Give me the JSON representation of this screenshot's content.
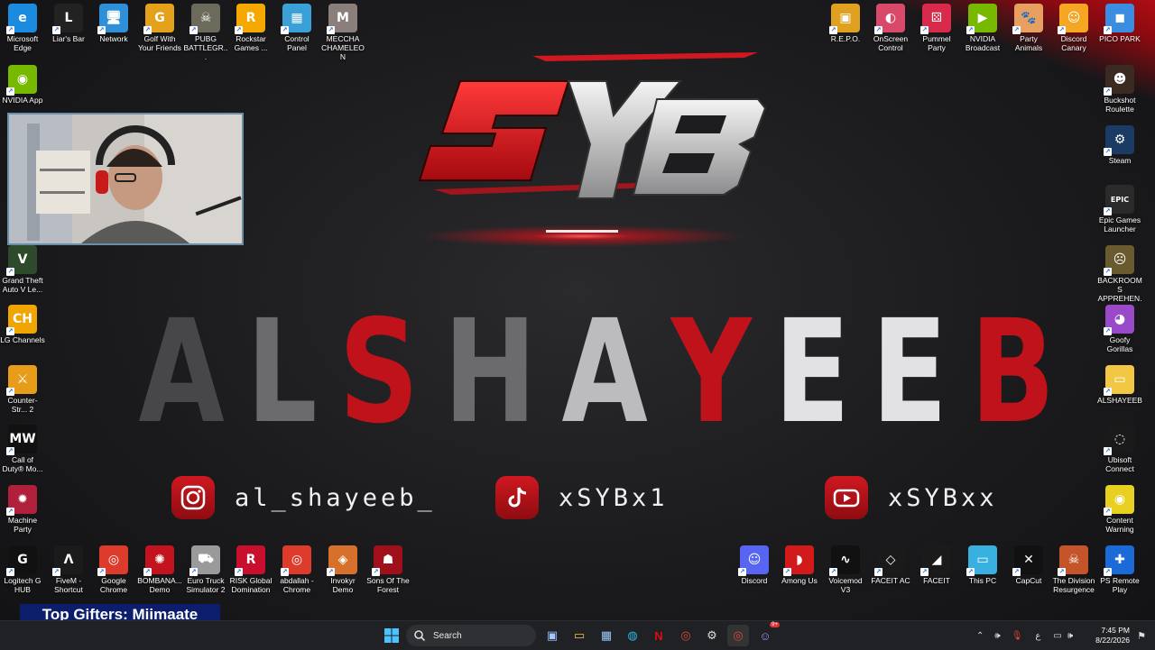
{
  "desktop_icons_left": [
    {
      "name": "edge",
      "label": "Microsoft Edge",
      "color": "#1b8be0",
      "glyph": "e"
    },
    {
      "name": "liars-bar",
      "label": "Liar's Bar",
      "color": "#222",
      "glyph": "L"
    },
    {
      "name": "network",
      "label": "Network",
      "color": "#2f8fd8",
      "glyph": "🖥"
    },
    {
      "name": "golf-with-friends",
      "label": "Golf With Your Friends",
      "color": "#e3a21a",
      "glyph": "G"
    },
    {
      "name": "pubg",
      "label": "PUBG BATTLEGR...",
      "color": "#6c6a5a",
      "glyph": "☠"
    },
    {
      "name": "rockstar",
      "label": "Rockstar Games ...",
      "color": "#f5a800",
      "glyph": "R"
    },
    {
      "name": "control-panel",
      "label": "Control Panel",
      "color": "#3aa0d8",
      "glyph": "▦"
    },
    {
      "name": "meccha-chameleon",
      "label": "MECCHA CHAMELEON",
      "color": "#8a7f7a",
      "glyph": "M"
    }
  ],
  "desktop_icons_col": [
    {
      "name": "nvidia-app",
      "label": "NVIDIA App",
      "color": "#76b900",
      "glyph": "◉"
    },
    {
      "name": "gta-v",
      "label": "Grand Theft Auto V Le...",
      "color": "#2d4a2a",
      "glyph": "V"
    },
    {
      "name": "lg-channels",
      "label": "LG Channels",
      "color": "#f0a500",
      "glyph": "CH"
    },
    {
      "name": "counter-strike",
      "label": "Counter-Str... 2",
      "color": "#e89d1a",
      "glyph": "⚔"
    },
    {
      "name": "call-of-duty",
      "label": "Call of Duty® Mo...",
      "color": "#111",
      "glyph": "MW"
    },
    {
      "name": "machine-party",
      "label": "Machine Party",
      "color": "#b0203a",
      "glyph": "✹"
    }
  ],
  "desktop_icons_bottom_left": [
    {
      "name": "logitech-g-hub",
      "label": "Logitech G HUB",
      "color": "#111",
      "glyph": "G"
    },
    {
      "name": "fivem",
      "label": "FiveM - Shortcut",
      "color": "#1b1b1b",
      "glyph": "Λ"
    },
    {
      "name": "google-chrome",
      "label": "Google Chrome",
      "color": "#dd3b2c",
      "glyph": "◎"
    },
    {
      "name": "bombanauts",
      "label": "BOMBANA... Demo",
      "color": "#c3131e",
      "glyph": "✺"
    },
    {
      "name": "euro-truck",
      "label": "Euro Truck Simulator 2",
      "color": "#9a9a9a",
      "glyph": "⛟"
    },
    {
      "name": "risk",
      "label": "RISK Global Domination",
      "color": "#c8102e",
      "glyph": "R"
    },
    {
      "name": "abdallah-chrome",
      "label": "abdallah - Chrome",
      "color": "#dd3b2c",
      "glyph": "◎"
    },
    {
      "name": "invokyr",
      "label": "Invokyr Demo",
      "color": "#d6702a",
      "glyph": "◈"
    },
    {
      "name": "sons-of-the-forest",
      "label": "Sons Of The Forest",
      "color": "#a0101a",
      "glyph": "☗"
    }
  ],
  "desktop_icons_top_right": [
    {
      "name": "repo",
      "label": "R.E.P.O.",
      "color": "#e0a020",
      "glyph": "▣"
    },
    {
      "name": "onscreen-control",
      "label": "OnScreen Control",
      "color": "#d94a6a",
      "glyph": "◐"
    },
    {
      "name": "pummel-party",
      "label": "Pummel Party",
      "color": "#d82a4a",
      "glyph": "⚄"
    },
    {
      "name": "nvidia-broadcast",
      "label": "NVIDIA Broadcast",
      "color": "#76b900",
      "glyph": "▶"
    },
    {
      "name": "party-animals",
      "label": "Party Animals",
      "color": "#e8a060",
      "glyph": "🐾"
    },
    {
      "name": "discord-canary",
      "label": "Discord Canary",
      "color": "#f5a623",
      "glyph": "☺"
    },
    {
      "name": "pico-park",
      "label": "PICO PARK",
      "color": "#3a8de0",
      "glyph": "◼"
    }
  ],
  "desktop_icons_right": [
    {
      "name": "buckshot-roulette",
      "label": "Buckshot Roulette",
      "color": "#3a2a22",
      "glyph": "☻"
    },
    {
      "name": "steam",
      "label": "Steam",
      "color": "#1b3b64",
      "glyph": "⚙"
    },
    {
      "name": "epic-games",
      "label": "Epic Games Launcher",
      "color": "#2a2a2a",
      "glyph": "EPIC"
    },
    {
      "name": "backrooms",
      "label": "BACKROOMS APPREHEN...",
      "color": "#6a5a30",
      "glyph": "☹"
    },
    {
      "name": "goofy-gorillas",
      "label": "Goofy Gorillas",
      "color": "#9a4ac8",
      "glyph": "◕"
    },
    {
      "name": "alshayeeb-folder",
      "label": "ALSHAYEEB",
      "color": "#f2c744",
      "glyph": "▭"
    },
    {
      "name": "ubisoft-connect",
      "label": "Ubisoft Connect",
      "color": "#1a1a1a",
      "glyph": "◌"
    },
    {
      "name": "content-warning",
      "label": "Content Warning",
      "color": "#e8d020",
      "glyph": "◉"
    },
    {
      "name": "ps-remote-play",
      "label": "PS Remote Play",
      "color": "#1a6ad8",
      "glyph": "✚"
    }
  ],
  "desktop_icons_bottom_right": [
    {
      "name": "discord",
      "label": "Discord",
      "color": "#5865f2",
      "glyph": "☺"
    },
    {
      "name": "among-us",
      "label": "Among Us",
      "color": "#d21a1a",
      "glyph": "◗"
    },
    {
      "name": "voicemod",
      "label": "Voicemod V3",
      "color": "#111",
      "glyph": "∿"
    },
    {
      "name": "faceit-ac",
      "label": "FACEIT AC",
      "color": "#1a1a1a",
      "glyph": "◇"
    },
    {
      "name": "faceit",
      "label": "FACEIT",
      "color": "#1a1a1a",
      "glyph": "◢"
    },
    {
      "name": "this-pc",
      "label": "This PC",
      "color": "#38b0e0",
      "glyph": "▭"
    },
    {
      "name": "capcut",
      "label": "CapCut",
      "color": "#111",
      "glyph": "✕"
    },
    {
      "name": "division-resurgence",
      "label": "The Division Resurgence",
      "color": "#c4552a",
      "glyph": "☠"
    }
  ],
  "wallpaper": {
    "logo_text": "SYB",
    "name_letters": [
      "A",
      "L",
      "S",
      "H",
      "A",
      "Y",
      "E",
      "E",
      "B"
    ],
    "name_classes": [
      "c-dark",
      "c-grey",
      "c-red",
      "c-grey",
      "c-lt",
      "c-red",
      "c-wh",
      "c-wh",
      "c-red"
    ],
    "socials": [
      {
        "platform": "instagram",
        "handle": "al_shayeeb_"
      },
      {
        "platform": "tiktok",
        "handle": "xSYBx1"
      },
      {
        "platform": "youtube",
        "handle": "xSYBxx"
      }
    ]
  },
  "overlay": {
    "top_gifters": "Top Gifters: Miimaate"
  },
  "taskbar": {
    "search_placeholder": "Search",
    "time": "7:45 PM",
    "date": "8/22/2026",
    "lang": "ع",
    "badge": "9+"
  },
  "colors": {
    "accent_red": "#c0121a",
    "taskbar": "#202124"
  }
}
